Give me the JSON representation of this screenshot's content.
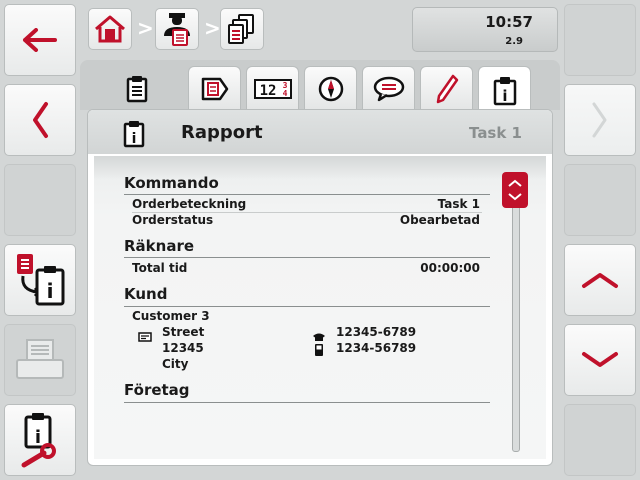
{
  "header": {
    "time": "10:57",
    "sub": "2.9",
    "breadcrumb": [
      "home-icon",
      "operator-task-icon",
      "task-list-icon"
    ],
    "separator": ">"
  },
  "tabs": [
    {
      "icon": "clipboard-icon"
    },
    {
      "icon": "order-forward-icon"
    },
    {
      "icon": "counter-123-icon",
      "text": "12",
      "sub": "34"
    },
    {
      "icon": "compass-icon"
    },
    {
      "icon": "comment-icon"
    },
    {
      "icon": "pencil-icon"
    },
    {
      "icon": "report-info-icon",
      "active": true
    }
  ],
  "panel": {
    "title": "Rapport",
    "task": "Task 1"
  },
  "sections": {
    "kommando": {
      "title": "Kommando",
      "rows": [
        {
          "label": "Orderbeteckning",
          "value": "Task 1"
        },
        {
          "label": "Orderstatus",
          "value": "Obearbetad"
        }
      ]
    },
    "raknare": {
      "title": "Räknare",
      "rows": [
        {
          "label": "Total tid",
          "value": "00:00:00"
        }
      ]
    },
    "kund": {
      "title": "Kund",
      "name": "Customer 3",
      "street": "Street",
      "zip": "12345",
      "city": "City",
      "phone": "12345-6789",
      "mobile": "1234-56789"
    },
    "foretag": {
      "title": "Företag"
    }
  },
  "colors": {
    "accent": "#c0112b",
    "background": "#d3d6d6",
    "icon": "#c0112b"
  }
}
